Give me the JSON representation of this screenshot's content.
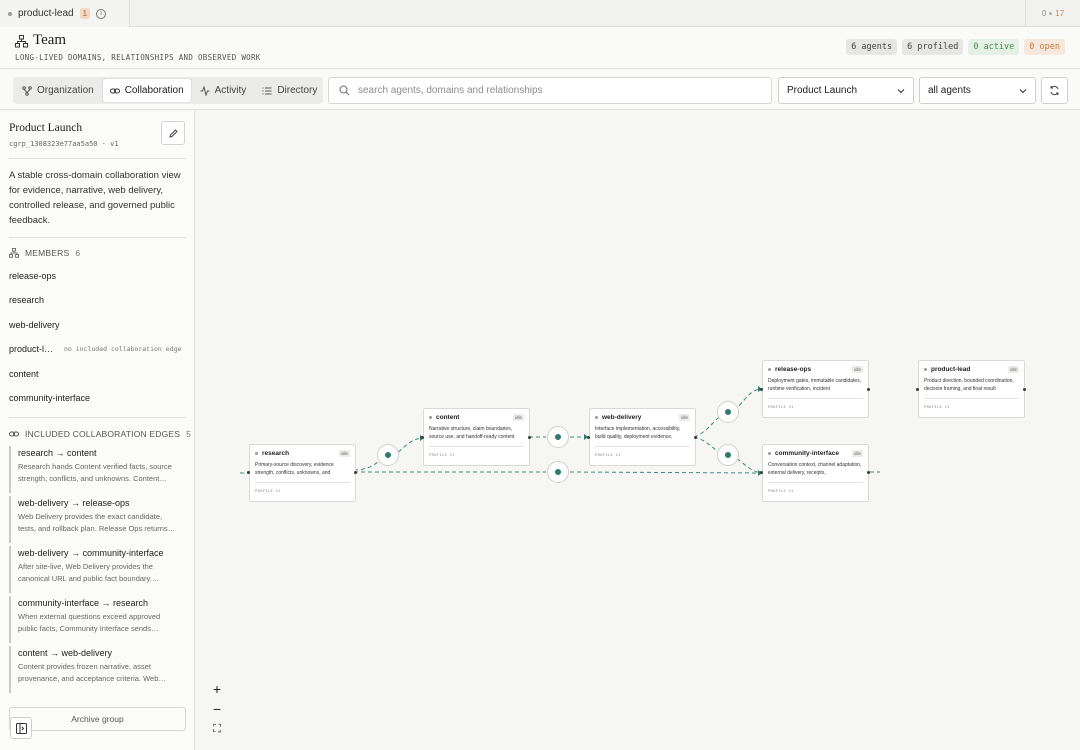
{
  "tabbar": {
    "active_tab": "product-lead",
    "badge": "1",
    "right_ok": "0",
    "right_warn": "17"
  },
  "header": {
    "title": "Team",
    "subtitle": "LONG-LIVED DOMAINS, RELATIONSHIPS AND OBSERVED WORK",
    "stats": {
      "agents": "6 agents",
      "profiled": "6 profiled",
      "active": "0 active",
      "open": "0 open"
    }
  },
  "toolbar": {
    "tabs": [
      {
        "label": "Organization",
        "icon": "org-chart-icon"
      },
      {
        "label": "Collaboration",
        "icon": "link-icon"
      },
      {
        "label": "Activity",
        "icon": "activity-icon"
      },
      {
        "label": "Directory",
        "icon": "list-icon"
      }
    ],
    "active_tab": "Collaboration",
    "search_placeholder": "search agents, domains and relationships",
    "group_select": "Product Launch",
    "agents_select": "all agents"
  },
  "sidebar": {
    "group_title": "Product Launch",
    "group_id": "cgrp_1308323e77aa5a50 · v1",
    "description": "A stable cross-domain collaboration view for evidence, narrative, web delivery, controlled release, and governed public feedback.",
    "members_label": "MEMBERS",
    "members_count": "6",
    "members": [
      "release-ops",
      "research",
      "web-delivery",
      "product-l…",
      "content",
      "community-interface"
    ],
    "member_note": "no included collaboration edge",
    "edges_label": "INCLUDED COLLABORATION EDGES",
    "edges_count": "5",
    "edges": [
      {
        "title": "research → content",
        "desc1": "Research hands Content verified facts, source",
        "desc2": "strength, conflicts, and unknowns. Content…"
      },
      {
        "title": "web-delivery → release-ops",
        "desc1": "Web Delivery provides the exact candidate,",
        "desc2": "tests, and rollback plan. Release Ops returns…"
      },
      {
        "title": "web-delivery → community-interface",
        "desc1": "After site-live, Web Delivery provides the",
        "desc2": "canonical URL and public fact boundary.…"
      },
      {
        "title": "community-interface → research",
        "desc1": "When external questions exceed approved",
        "desc2": "public facts, Community Interface sends…"
      },
      {
        "title": "content → web-delivery",
        "desc1": "Content provides frozen narrative, asset",
        "desc2": "provenance, and acceptance criteria. Web…"
      }
    ],
    "archive_label": "Archive group"
  },
  "canvas": {
    "nodes": [
      {
        "name": "research",
        "badge": "idle",
        "desc": "Primary-source discovery, evidence strength, conflicts, unknowns, and",
        "profile": "PROFILE V1"
      },
      {
        "name": "content",
        "badge": "idle",
        "desc": "Narrative structure, claim boundaries, source use, and handoff-ready content",
        "profile": "PROFILE V1"
      },
      {
        "name": "web-delivery",
        "badge": "idle",
        "desc": "Interface implementation, accessibility, build quality, deployment evidence,",
        "profile": "PROFILE V1"
      },
      {
        "name": "release-ops",
        "badge": "idle",
        "desc": "Deployment gates, immutable candidates, runtime verification, incident",
        "profile": "PROFILE V1"
      },
      {
        "name": "community-interface",
        "badge": "idle",
        "desc": "Conversation context, channel adaptation, external delivery, receipts,",
        "profile": "PROFILE V1"
      },
      {
        "name": "product-lead",
        "badge": "idle",
        "desc": "Product direction, bounded coordination, decision framing, and final result",
        "profile": "PROFILE V1"
      }
    ],
    "zoom": {
      "in": "+",
      "out": "−",
      "fit": "⛶"
    }
  },
  "colors": {
    "edge": "#2e7a6f",
    "accent_green": "#4c8a57",
    "accent_orange": "#c47a3b"
  }
}
